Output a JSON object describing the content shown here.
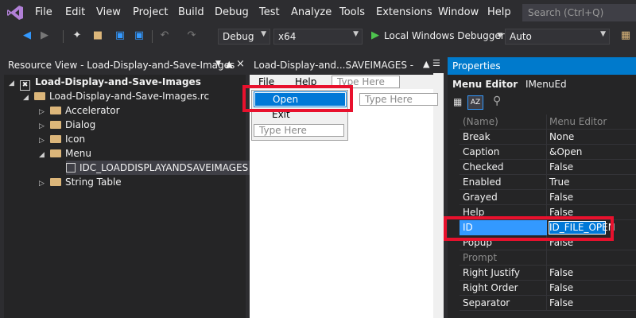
{
  "menubar": {
    "items": [
      "File",
      "Edit",
      "View",
      "Project",
      "Build",
      "Debug",
      "Test",
      "Analyze",
      "Tools",
      "Extensions",
      "Window",
      "Help"
    ],
    "search_placeholder": "Search (Ctrl+Q)"
  },
  "toolbar": {
    "configuration": "Debug",
    "platform": "x64",
    "debugger": "Local Windows Debugger",
    "mode": "Auto"
  },
  "resource_view": {
    "title": "Resource View - Load-Display-and-Save-Images",
    "tree": [
      {
        "label": "Load-Display-and-Save-Images",
        "level": 0,
        "expanded": true
      },
      {
        "label": "Load-Display-and-Save-Images.rc",
        "level": 1,
        "expanded": true
      },
      {
        "label": "Accelerator",
        "level": 2,
        "expanded": false
      },
      {
        "label": "Dialog",
        "level": 2,
        "expanded": false
      },
      {
        "label": "Icon",
        "level": 2,
        "expanded": false
      },
      {
        "label": "Menu",
        "level": 2,
        "expanded": true
      },
      {
        "label": "IDC_LOADDISPLAYANDSAVEIMAGES",
        "level": 3,
        "selected": true
      },
      {
        "label": "String Table",
        "level": 2,
        "expanded": false
      }
    ]
  },
  "editor": {
    "tab_title": "Load-Display-and...SAVEIMAGES -",
    "menu_labels": [
      "File",
      "Help"
    ],
    "type_here": "Type Here",
    "dropdown_items": [
      "Open",
      "Exit"
    ]
  },
  "properties": {
    "title": "Properties",
    "object_name": "Menu Editor",
    "object_type": "IMenuEd",
    "rows": [
      {
        "name": "(Name)",
        "value": "Menu Editor",
        "muted": true
      },
      {
        "name": "Break",
        "value": "None"
      },
      {
        "name": "Caption",
        "value": "&Open"
      },
      {
        "name": "Checked",
        "value": "False"
      },
      {
        "name": "Enabled",
        "value": "True"
      },
      {
        "name": "Grayed",
        "value": "False"
      },
      {
        "name": "Help",
        "value": "False"
      },
      {
        "name": "ID",
        "value": "ID_FILE_OPEN",
        "selected": true
      },
      {
        "name": "Popup",
        "value": "False"
      },
      {
        "name": "Prompt",
        "value": "",
        "muted": true
      },
      {
        "name": "Right Justify",
        "value": "False"
      },
      {
        "name": "Right Order",
        "value": "False"
      },
      {
        "name": "Separator",
        "value": "False"
      }
    ]
  },
  "colors": {
    "accent": "#007acc",
    "highlight_box": "#e8112d",
    "selection": "#3399ff"
  }
}
